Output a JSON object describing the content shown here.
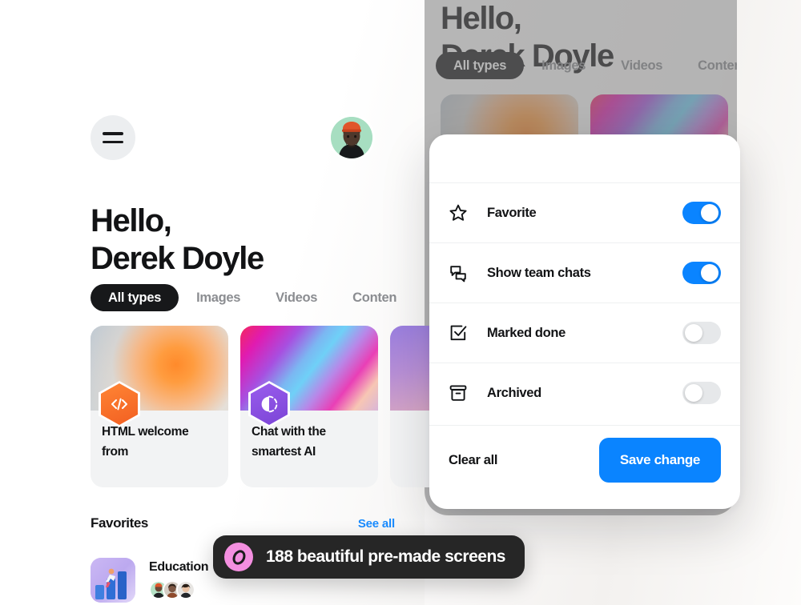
{
  "app": {
    "greeting_line1": "Hello,",
    "greeting_line2": "Derek Doyle",
    "user_name": "Derek Doyle"
  },
  "nav": {
    "menu_icon": "hamburger-menu-icon",
    "avatar_label": "Derek Doyle avatar"
  },
  "tabs": [
    {
      "label": "All types",
      "active": true
    },
    {
      "label": "Images",
      "active": false
    },
    {
      "label": "Videos",
      "active": false
    },
    {
      "label": "Conten",
      "active": false
    }
  ],
  "cards": [
    {
      "title_line1": "HTML welcome",
      "title_line2": "from",
      "icon": "code-brackets-icon",
      "icon_color": "#F2601F"
    },
    {
      "title_line1": "Chat with the",
      "title_line2": "smartest AI",
      "icon": "contrast-circle-icon",
      "icon_color": "#8A4FE3"
    },
    {
      "title_line1": "",
      "title_line2": "",
      "icon": "",
      "icon_color": "#B08FD8"
    }
  ],
  "favorites": {
    "section_title": "Favorites",
    "see_all_label": "See all",
    "see_all_color": "#1A8CFF",
    "items": [
      {
        "name": "Education",
        "members": 3
      }
    ]
  },
  "sheet": {
    "options": [
      {
        "label": "Favorite",
        "icon": "star-icon",
        "enabled": true
      },
      {
        "label": "Show team chats",
        "icon": "chat-bubbles-icon",
        "enabled": true
      },
      {
        "label": "Marked done",
        "icon": "check-square-icon",
        "enabled": false
      },
      {
        "label": "Archived",
        "icon": "archive-box-icon",
        "enabled": false
      }
    ],
    "clear_label": "Clear all",
    "save_label": "Save change",
    "accent_color": "#0A84FF",
    "toggle_off_color": "#E6E8EA"
  },
  "banner": {
    "text": "188 beautiful pre-made screens",
    "badge_icon": "ring-mark-icon",
    "badge_color": "#F48FE0",
    "background": "#262626"
  }
}
